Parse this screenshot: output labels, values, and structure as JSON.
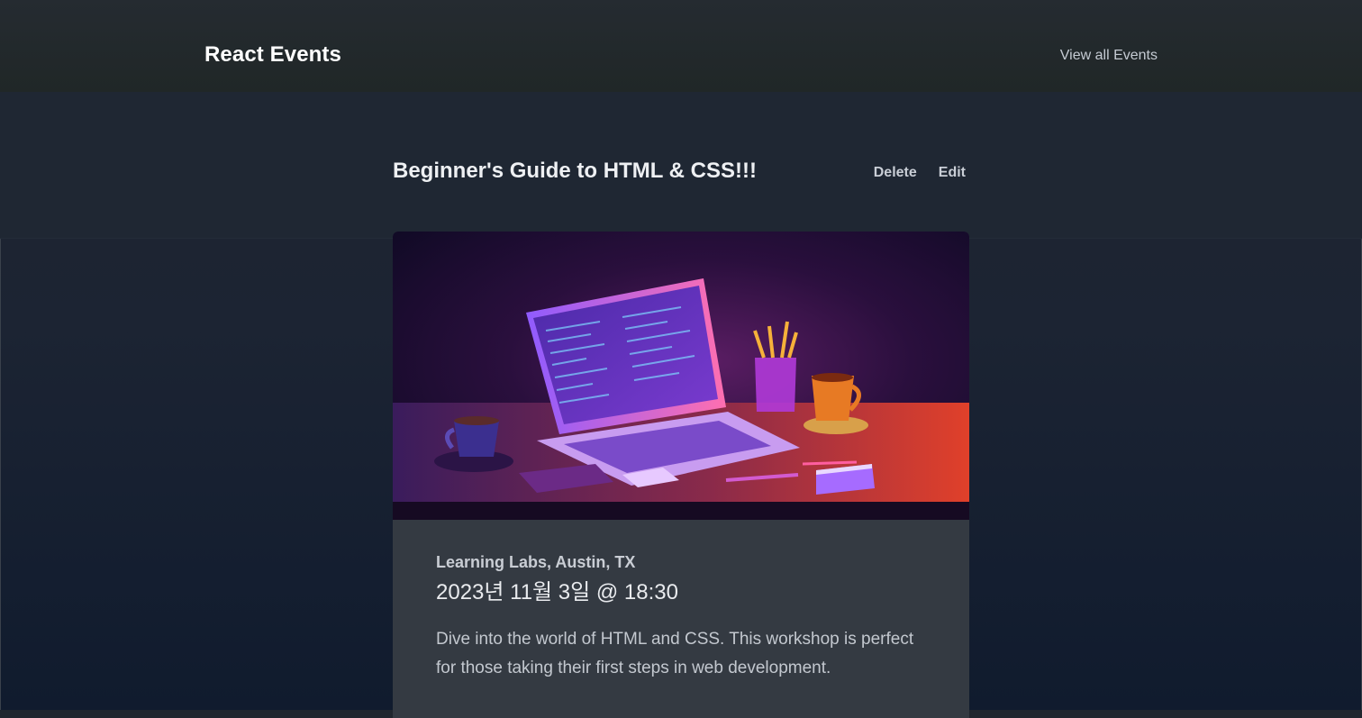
{
  "header": {
    "brand": "React Events",
    "nav_link": "View all Events"
  },
  "event": {
    "title": "Beginner's Guide to HTML & CSS!!!",
    "actions": {
      "delete_label": "Delete",
      "edit_label": "Edit"
    },
    "image": {
      "subject": "laptop with code on desk, coffee cups, pencil jar",
      "accent": "#c94bf5"
    },
    "location": "Learning Labs, Austin, TX",
    "datetime": "2023년 11월 3일 @ 18:30",
    "description": "Dive into the world of HTML and CSS. This workshop is perfect for those taking their first steps in web development."
  },
  "colors": {
    "header_bg": "#232a2c",
    "page_bg": "#1c2433",
    "card_bg": "#343a42",
    "text_primary": "#eef0f3"
  }
}
